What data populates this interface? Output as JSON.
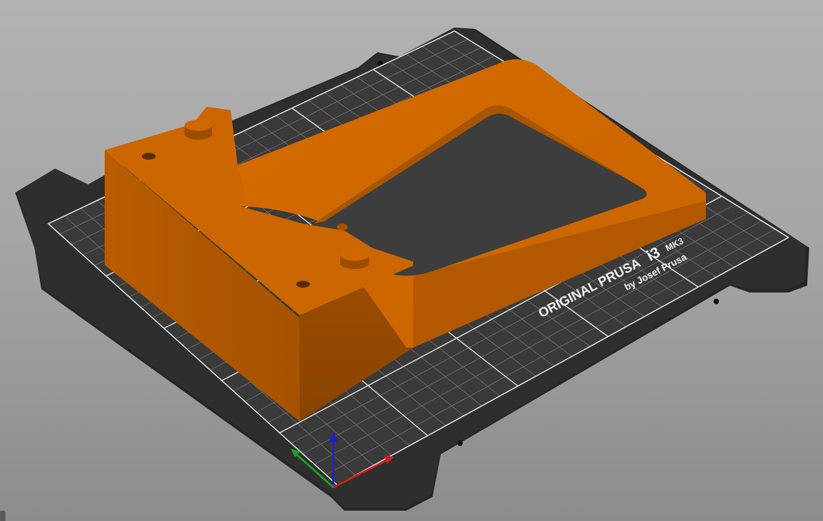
{
  "bed": {
    "brand": "ORIGINAL PRUSA",
    "model": "i3",
    "version": "MK3",
    "maker": "by Josef Prusa"
  },
  "colors": {
    "background_top": "#b2b2b2",
    "background_bottom": "#8c8c8c",
    "bed_plate": "#2e2e2e",
    "bed_plate_edge": "#1a1a1a",
    "grid_minor": "#8a8a8a",
    "grid_major": "#e6e6e6",
    "part_top": "#cc6600",
    "part_side_light": "#b35900",
    "part_side_dark": "#8a4400",
    "axis_x": "#cc2222",
    "axis_y": "#22aa22",
    "axis_z": "#2222cc"
  },
  "axes": {
    "x_icon": "x-axis-arrow-icon",
    "y_icon": "y-axis-arrow-icon",
    "z_icon": "z-axis-arrow-icon"
  }
}
